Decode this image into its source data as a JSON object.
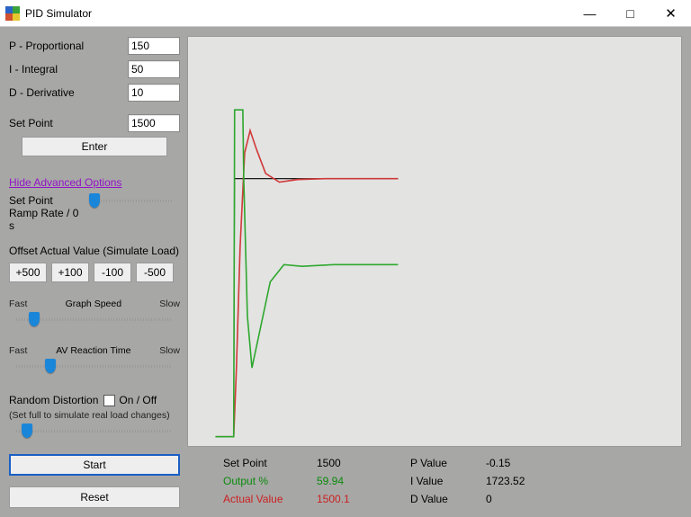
{
  "window": {
    "title": "PID Simulator"
  },
  "params": {
    "p": {
      "label": "P - Proportional",
      "value": "150"
    },
    "i": {
      "label": "I - Integral",
      "value": "50"
    },
    "d": {
      "label": "D - Derivative",
      "value": "10"
    },
    "setpoint": {
      "label": "Set Point",
      "value": "1500"
    },
    "enter": "Enter"
  },
  "advanced": {
    "toggle_label": "Hide Advanced Options",
    "ramp": {
      "label1": "Set Point",
      "label2": "Ramp Rate /  0 s"
    },
    "offset": {
      "label": "Offset Actual Value (Simulate Load)",
      "buttons": [
        "+500",
        "+100",
        "-100",
        "-500"
      ]
    },
    "graph_speed": {
      "fast": "Fast",
      "label": "Graph Speed",
      "slow": "Slow"
    },
    "reaction": {
      "fast": "Fast",
      "label": "AV Reaction Time",
      "slow": "Slow"
    },
    "distortion": {
      "label": "Random Distortion",
      "onoff": "On / Off",
      "sub": "(Set full to simulate real load changes)"
    }
  },
  "actions": {
    "start": "Start",
    "reset": "Reset"
  },
  "readout": {
    "setpoint": {
      "label": "Set Point",
      "value": "1500"
    },
    "output": {
      "label": "Output  %",
      "value": "59.94"
    },
    "actual": {
      "label": "Actual Value",
      "value": "1500.1"
    },
    "pval": {
      "label": "P Value",
      "value": "-0.15"
    },
    "ival": {
      "label": "I Value",
      "value": "1723.52"
    },
    "dval": {
      "label": "D Value",
      "value": "0"
    }
  },
  "chart_data": {
    "type": "line",
    "x_range": [
      0,
      200
    ],
    "y_range": [
      0,
      2000
    ],
    "setpoint_y": 1500,
    "series": [
      {
        "name": "Set Point",
        "color": "#000000",
        "x": [
          0,
          20,
          21,
          200
        ],
        "values": [
          0,
          0,
          1500,
          1500
        ]
      },
      {
        "name": "Actual Value",
        "color": "#d03a3a",
        "x": [
          0,
          20,
          23,
          27,
          32,
          38,
          45,
          55,
          70,
          90,
          120,
          160,
          200
        ],
        "values": [
          0,
          0,
          400,
          1100,
          1650,
          1780,
          1670,
          1530,
          1480,
          1495,
          1500,
          1500,
          1500
        ]
      },
      {
        "name": "Output %",
        "color": "#2fa82f",
        "x": [
          0,
          20,
          21,
          30,
          31,
          35,
          40,
          48,
          60,
          75,
          95,
          130,
          170,
          200
        ],
        "values": [
          0,
          0,
          1900,
          1900,
          1500,
          700,
          400,
          600,
          900,
          1000,
          990,
          1000,
          1000,
          1000
        ]
      }
    ]
  }
}
